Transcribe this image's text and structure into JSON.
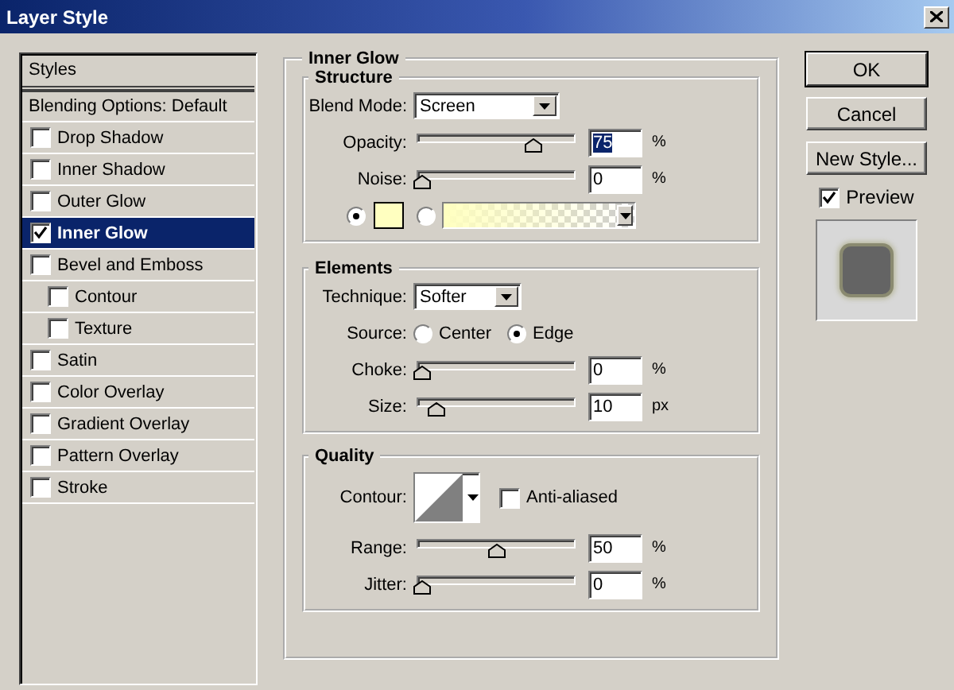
{
  "window": {
    "title": "Layer Style"
  },
  "styles_list": {
    "header": "Styles",
    "items": [
      {
        "label": "Blending Options: Default",
        "kind": "plain",
        "selected": false
      },
      {
        "label": "Drop Shadow",
        "kind": "checkbox",
        "checked": false,
        "selected": false
      },
      {
        "label": "Inner Shadow",
        "kind": "checkbox",
        "checked": false,
        "selected": false
      },
      {
        "label": "Outer Glow",
        "kind": "checkbox",
        "checked": false,
        "selected": false
      },
      {
        "label": "Inner Glow",
        "kind": "checkbox",
        "checked": true,
        "selected": true
      },
      {
        "label": "Bevel and Emboss",
        "kind": "checkbox",
        "checked": false,
        "selected": false,
        "children": [
          {
            "label": "Contour",
            "kind": "checkbox",
            "checked": false,
            "selected": false
          },
          {
            "label": "Texture",
            "kind": "checkbox",
            "checked": false,
            "selected": false
          }
        ]
      },
      {
        "label": "Satin",
        "kind": "checkbox",
        "checked": false,
        "selected": false
      },
      {
        "label": "Color Overlay",
        "kind": "checkbox",
        "checked": false,
        "selected": false
      },
      {
        "label": "Gradient Overlay",
        "kind": "checkbox",
        "checked": false,
        "selected": false
      },
      {
        "label": "Pattern Overlay",
        "kind": "checkbox",
        "checked": false,
        "selected": false
      },
      {
        "label": "Stroke",
        "kind": "checkbox",
        "checked": false,
        "selected": false
      }
    ]
  },
  "panel": {
    "title": "Inner Glow",
    "structure": {
      "title": "Structure",
      "blend_mode": {
        "label": "Blend Mode:",
        "value": "Screen"
      },
      "sliders": [
        {
          "label": "Opacity:",
          "level": 0.75,
          "value": "75",
          "unit": "%",
          "highlighted": true
        },
        {
          "label": "Noise:",
          "level": 0,
          "value": "0",
          "unit": "%",
          "highlighted": false
        }
      ],
      "fill_options": [
        {
          "kind": "color",
          "selected": true,
          "color": "#ffffc0"
        },
        {
          "kind": "gradient",
          "selected": false
        }
      ]
    },
    "elements": {
      "title": "Elements",
      "technique": {
        "label": "Technique:",
        "value": "Softer"
      },
      "source": {
        "label": "Source:",
        "options": [
          {
            "label": "Center",
            "selected": false
          },
          {
            "label": "Edge",
            "selected": true
          }
        ]
      },
      "sliders": [
        {
          "label": "Choke:",
          "level": 0,
          "value": "0",
          "unit": "%",
          "highlighted": false
        },
        {
          "label": "Size:",
          "level": 0.1,
          "value": "10",
          "unit": "px",
          "highlighted": false
        }
      ]
    },
    "quality": {
      "title": "Quality",
      "contour": {
        "label": "Contour:"
      },
      "anti_aliased": {
        "label": "Anti-aliased",
        "checked": false
      },
      "sliders": [
        {
          "label": "Range:",
          "level": 0.5,
          "value": "50",
          "unit": "%",
          "highlighted": false
        },
        {
          "label": "Jitter:",
          "level": 0,
          "value": "0",
          "unit": "%",
          "highlighted": false
        }
      ]
    }
  },
  "buttons": [
    {
      "label": "OK",
      "default": true
    },
    {
      "label": "Cancel",
      "default": false
    },
    {
      "label": "New Style...",
      "default": false
    }
  ],
  "preview": {
    "label": "Preview",
    "checked": true
  }
}
